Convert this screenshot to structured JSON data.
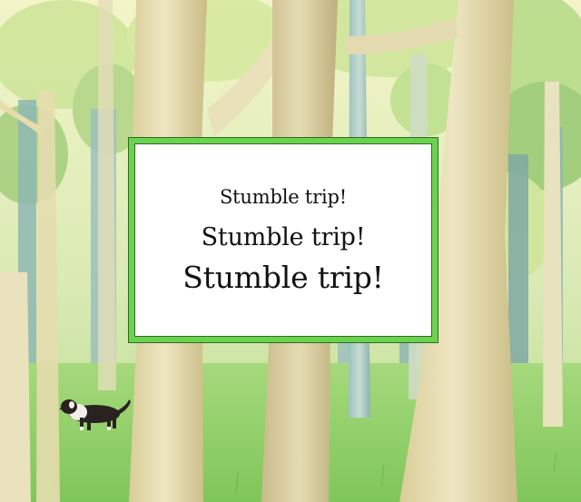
{
  "illustration": {
    "subject": "forest-with-dog",
    "colors": {
      "sky": "#f3f5c8",
      "foliage_light": "#cfe59a",
      "foliage_mid": "#9ccb76",
      "foliage_dark": "#5f9b7a",
      "trunk_light": "#e8dfb6",
      "trunk_shadow": "#cfc28f",
      "distant_trees": "#8fb8b3",
      "grass": "#8fd06a",
      "dog_coat": "#2a2220",
      "dog_white": "#f2efe8"
    }
  },
  "text_card": {
    "lines": [
      "Stumble trip!",
      "Stumble trip!",
      "Stumble trip!"
    ],
    "border_color": "#6bd24f"
  }
}
